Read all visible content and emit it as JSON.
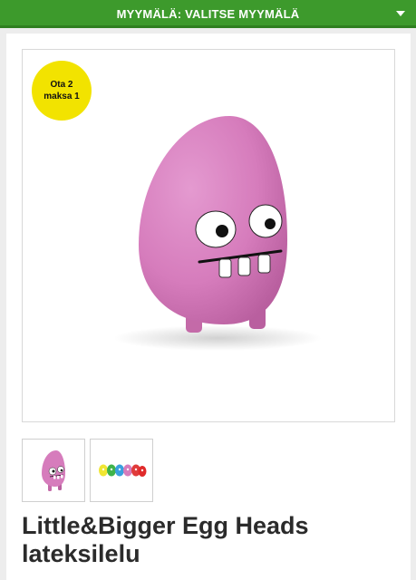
{
  "topbar": {
    "store_label": "MYYMÄLÄ: VALITSE MYYMÄLÄ",
    "dropdown_icon": "chevron-down-icon"
  },
  "product": {
    "badge_text": "Ota 2 maksa 1",
    "badge_color": "#f2e300",
    "title": "Little&Bigger Egg Heads lateksilelu",
    "main_color": "#d97bbd",
    "thumbnails": [
      "pink-egg-head",
      "egg-heads-set"
    ]
  },
  "colors": {
    "header_green": "#3d9a2c",
    "background": "#ededed"
  }
}
